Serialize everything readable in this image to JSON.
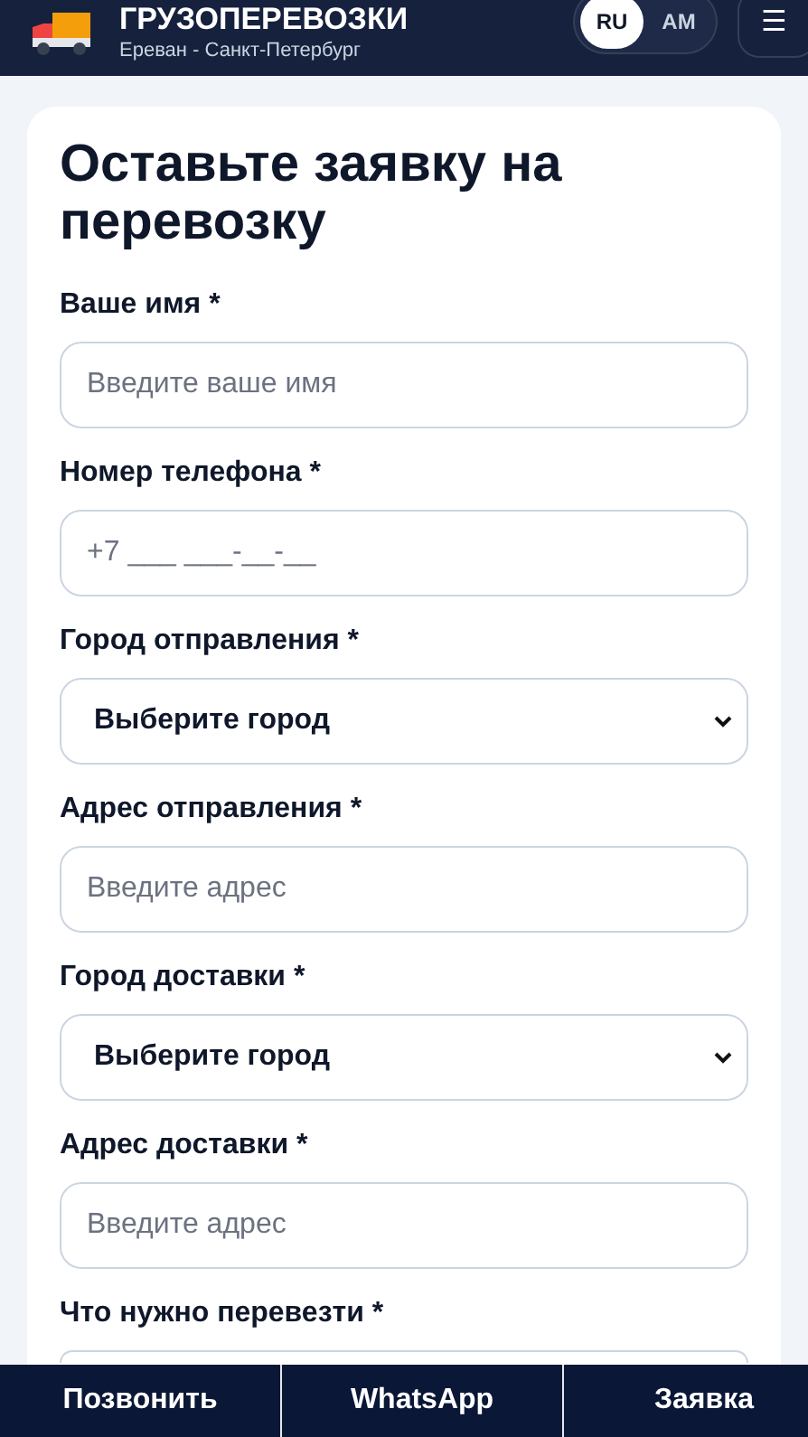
{
  "header": {
    "title": "ГРУЗОПЕРЕВОЗКИ",
    "subtitle": "Ереван - Санкт-Петербург",
    "languages": [
      {
        "label": "RU",
        "selected": true
      },
      {
        "label": "AM",
        "selected": false
      }
    ],
    "menu": "☰"
  },
  "form": {
    "title": "Оставьте заявку на перевозку",
    "fields": [
      {
        "kind": "input",
        "label": "Ваше имя *",
        "placeholder": "Введите ваше имя"
      },
      {
        "kind": "input",
        "label": "Номер телефона *",
        "placeholder": "+7 ___ ___-__-__"
      },
      {
        "kind": "select",
        "label": "Город отправления *",
        "value": "Выберите город"
      },
      {
        "kind": "input",
        "label": "Адрес отправления *",
        "placeholder": "Введите адрес"
      },
      {
        "kind": "select",
        "label": "Город доставки *",
        "value": "Выберите город"
      },
      {
        "kind": "input",
        "label": "Адрес доставки *",
        "placeholder": "Введите адрес"
      },
      {
        "kind": "input",
        "label": "Что нужно перевезти *"
      }
    ]
  },
  "bottom_bar": [
    "Позвонить",
    "WhatsApp",
    "Заявка"
  ]
}
